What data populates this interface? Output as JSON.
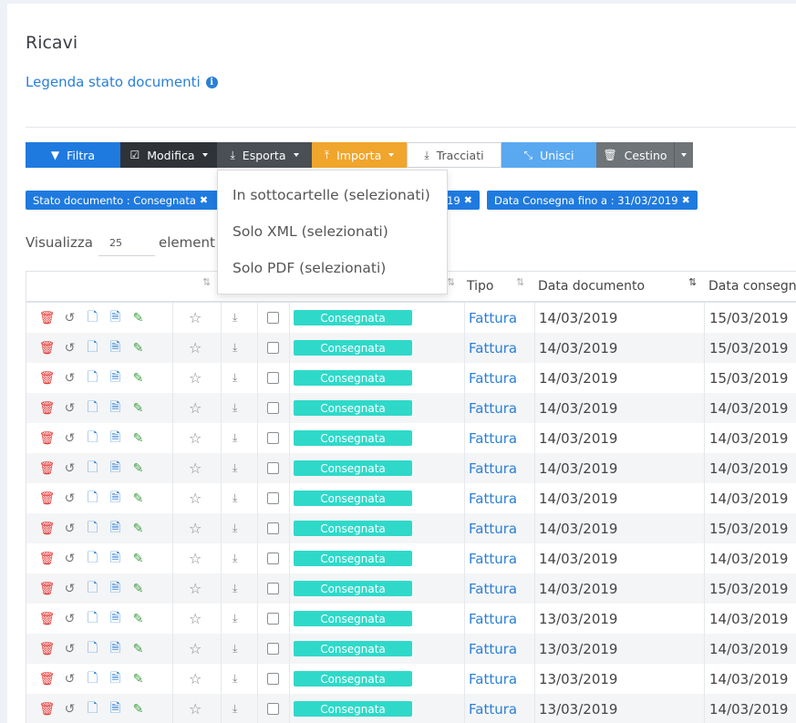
{
  "page": {
    "title": "Ricavi",
    "legend_link": "Legenda stato documenti"
  },
  "toolbar": {
    "filtra": "Filtra",
    "modifica": "Modifica",
    "esporta": "Esporta",
    "importa": "Importa",
    "tracciati": "Tracciati",
    "unisci": "Unisci",
    "cestino": "Cestino"
  },
  "filters": {
    "chip1": "Stato documento : Consegnata",
    "chip2_tail": "19",
    "chip3": "Data Consegna fino a : 31/03/2019"
  },
  "dropdown": {
    "items": [
      "In sottocartelle (selezionati)",
      "Solo XML (selezionati)",
      "Solo PDF (selezionati)"
    ]
  },
  "paging": {
    "label": "Visualizza",
    "value": "25",
    "suffix": "element"
  },
  "table": {
    "headers": {
      "tipo": "Tipo",
      "data_documento": "Data documento",
      "data_consegna": "Data consegn"
    },
    "rows": [
      {
        "stato": "Consegnata",
        "tipo": "Fattura",
        "data_documento": "14/03/2019",
        "data_consegna": "15/03/2019"
      },
      {
        "stato": "Consegnata",
        "tipo": "Fattura",
        "data_documento": "14/03/2019",
        "data_consegna": "15/03/2019"
      },
      {
        "stato": "Consegnata",
        "tipo": "Fattura",
        "data_documento": "14/03/2019",
        "data_consegna": "15/03/2019"
      },
      {
        "stato": "Consegnata",
        "tipo": "Fattura",
        "data_documento": "14/03/2019",
        "data_consegna": "14/03/2019"
      },
      {
        "stato": "Consegnata",
        "tipo": "Fattura",
        "data_documento": "14/03/2019",
        "data_consegna": "14/03/2019"
      },
      {
        "stato": "Consegnata",
        "tipo": "Fattura",
        "data_documento": "14/03/2019",
        "data_consegna": "14/03/2019"
      },
      {
        "stato": "Consegnata",
        "tipo": "Fattura",
        "data_documento": "14/03/2019",
        "data_consegna": "14/03/2019"
      },
      {
        "stato": "Consegnata",
        "tipo": "Fattura",
        "data_documento": "14/03/2019",
        "data_consegna": "15/03/2019"
      },
      {
        "stato": "Consegnata",
        "tipo": "Fattura",
        "data_documento": "14/03/2019",
        "data_consegna": "14/03/2019"
      },
      {
        "stato": "Consegnata",
        "tipo": "Fattura",
        "data_documento": "14/03/2019",
        "data_consegna": "15/03/2019"
      },
      {
        "stato": "Consegnata",
        "tipo": "Fattura",
        "data_documento": "13/03/2019",
        "data_consegna": "14/03/2019"
      },
      {
        "stato": "Consegnata",
        "tipo": "Fattura",
        "data_documento": "13/03/2019",
        "data_consegna": "14/03/2019"
      },
      {
        "stato": "Consegnata",
        "tipo": "Fattura",
        "data_documento": "13/03/2019",
        "data_consegna": "14/03/2019"
      },
      {
        "stato": "Consegnata",
        "tipo": "Fattura",
        "data_documento": "13/03/2019",
        "data_consegna": "14/03/2019"
      }
    ]
  },
  "icons": {
    "filtra": "filter-icon",
    "modifica": "check-square-icon",
    "esporta": "download-icon",
    "importa": "upload-icon",
    "tracciati": "download-icon",
    "unisci": "merge-icon",
    "cestino": "trash-icon",
    "row_actions": [
      "trash-icon",
      "undo-icon",
      "file-icon",
      "pdf-icon",
      "paperclip-icon"
    ]
  },
  "colors": {
    "primary": "#1f7adf",
    "dark": "#2f3338",
    "orange": "#f0a52d",
    "light_blue": "#5aa8f0",
    "gray": "#6f7479",
    "badge": "#2fd9c9",
    "delete": "#e53935",
    "attach": "#43a047"
  }
}
